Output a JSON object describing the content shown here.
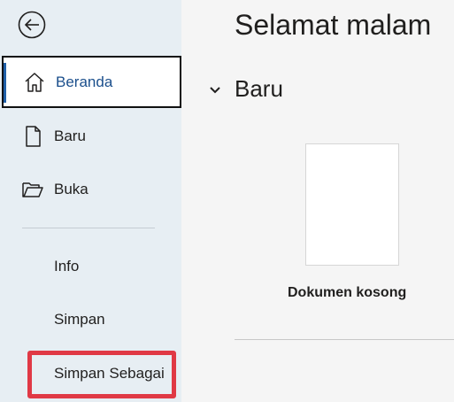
{
  "sidebar": {
    "back_label": "back",
    "items": [
      {
        "label": "Beranda",
        "icon": "home-icon",
        "active": true
      },
      {
        "label": "Baru",
        "icon": "new-document-icon"
      },
      {
        "label": "Buka",
        "icon": "folder-open-icon"
      }
    ],
    "text_items": [
      {
        "label": "Info"
      },
      {
        "label": "Simpan"
      },
      {
        "label": "Simpan Sebagai",
        "highlighted": true
      }
    ]
  },
  "main": {
    "greeting": "Selamat malam",
    "section_title": "Baru",
    "templates": [
      {
        "label": "Dokumen kosong"
      }
    ]
  },
  "colors": {
    "sidebar_bg": "#e7eef3",
    "accent": "#1f5fa8",
    "highlight": "#e03945",
    "main_bg": "#f5f5f5"
  }
}
